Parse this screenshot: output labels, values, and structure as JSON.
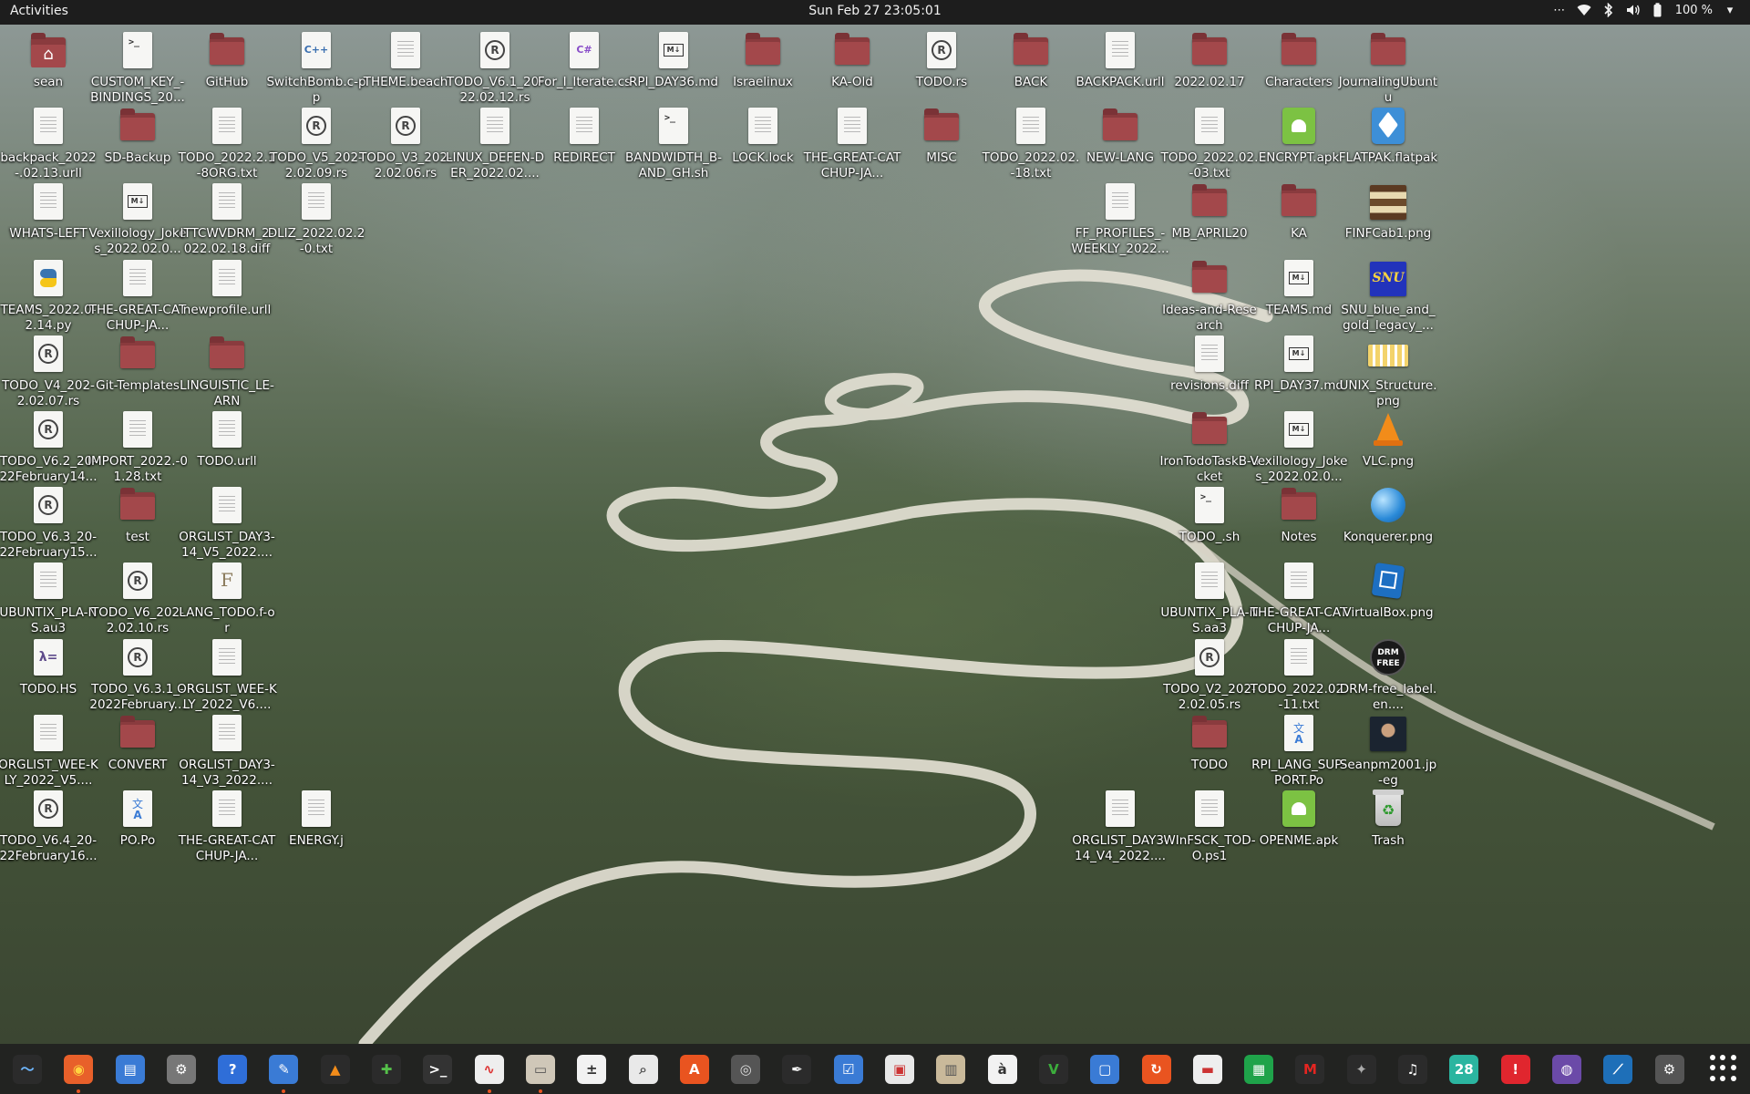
{
  "topbar": {
    "activities": "Activities",
    "clock": "Sun Feb 27  23:05:01",
    "battery": "100 %",
    "icons": [
      "overflow-icon",
      "wifi-icon",
      "bluetooth-icon",
      "volume-icon",
      "battery-icon",
      "chevron-down-icon"
    ]
  },
  "desktop": {
    "items": [
      {
        "label": "sean",
        "type": "home",
        "col": 0,
        "row": 0
      },
      {
        "label": "CUSTOM_KEY_-BINDINGS_20...",
        "type": "term",
        "col": 1,
        "row": 0
      },
      {
        "label": "GitHub",
        "type": "folder",
        "col": 2,
        "row": 0
      },
      {
        "label": "SwitchBomb.c-pp",
        "type": "cpp",
        "col": 3,
        "row": 0
      },
      {
        "label": "THEME.beach",
        "type": "file",
        "col": 4,
        "row": 0
      },
      {
        "label": "TODO_V6.1_20-22.02.12.rs",
        "type": "rust",
        "col": 5,
        "row": 0
      },
      {
        "label": "For_I_Iterate.cs",
        "type": "cs",
        "col": 6,
        "row": 0
      },
      {
        "label": "RPI_DAY36.md",
        "type": "md",
        "col": 7,
        "row": 0
      },
      {
        "label": "Israelinux",
        "type": "folder",
        "col": 8,
        "row": 0
      },
      {
        "label": "KA-Old",
        "type": "folder",
        "col": 9,
        "row": 0
      },
      {
        "label": "TODO.rs",
        "type": "rust",
        "col": 10,
        "row": 0
      },
      {
        "label": "BACK",
        "type": "folder",
        "col": 11,
        "row": 0
      },
      {
        "label": "BACKPACK.urll",
        "type": "file",
        "col": 12,
        "row": 0
      },
      {
        "label": "2022.02.17",
        "type": "folder",
        "col": 13,
        "row": 0
      },
      {
        "label": "Characters",
        "type": "folder",
        "col": 14,
        "row": 0
      },
      {
        "label": "JournalingUbuntu",
        "type": "folder",
        "col": 15,
        "row": 0
      },
      {
        "label": "backpack_2022-.02.13.urll",
        "type": "file",
        "col": 0,
        "row": 1
      },
      {
        "label": "SD-Backup",
        "type": "folder",
        "col": 1,
        "row": 1
      },
      {
        "label": "TODO_2022.2.1-8ORG.txt",
        "type": "file",
        "col": 2,
        "row": 1
      },
      {
        "label": "TODO_V5_202-2.02.09.rs",
        "type": "rust",
        "col": 3,
        "row": 1
      },
      {
        "label": "TODO_V3_202-2.02.06.rs",
        "type": "rust",
        "col": 4,
        "row": 1
      },
      {
        "label": "LINUX_DEFEN-DER_2022.02....",
        "type": "file",
        "col": 5,
        "row": 1
      },
      {
        "label": "REDIRECT",
        "type": "file",
        "col": 6,
        "row": 1
      },
      {
        "label": "BANDWIDTH_B-AND_GH.sh",
        "type": "term",
        "col": 7,
        "row": 1
      },
      {
        "label": "LOCK.lock",
        "type": "file",
        "col": 8,
        "row": 1
      },
      {
        "label": "THE-GREAT-CATCHUP-JA...",
        "type": "file",
        "col": 9,
        "row": 1
      },
      {
        "label": "MISC",
        "type": "folder",
        "col": 10,
        "row": 1
      },
      {
        "label": "TODO_2022.02.-18.txt",
        "type": "file",
        "col": 11,
        "row": 1
      },
      {
        "label": "NEW-LANG",
        "type": "folder",
        "col": 12,
        "row": 1
      },
      {
        "label": "TODO_2022.02.-03.txt",
        "type": "file",
        "col": 13,
        "row": 1
      },
      {
        "label": "ENCRYPT.apk",
        "type": "apk",
        "col": 14,
        "row": 1
      },
      {
        "label": "FLATPAK.flatpak",
        "type": "flatpak",
        "col": 15,
        "row": 1
      },
      {
        "label": "WHATS-LEFT",
        "type": "file",
        "col": 0,
        "row": 2
      },
      {
        "label": "Vexillology_Jokes_2022.02.0...",
        "type": "md",
        "col": 1,
        "row": 2
      },
      {
        "label": "ITTCWVDRM_2-022.02.18.diff",
        "type": "file",
        "col": 2,
        "row": 2
      },
      {
        "label": "DLIZ_2022.02.2-0.txt",
        "type": "file",
        "col": 3,
        "row": 2
      },
      {
        "label": "FF_PROFILES_-WEEKLY_2022...",
        "type": "file",
        "col": 12,
        "row": 2
      },
      {
        "label": "MB_APRIL20",
        "type": "folder",
        "col": 13,
        "row": 2
      },
      {
        "label": "KA",
        "type": "folder",
        "col": 14,
        "row": 2
      },
      {
        "label": "FINFCab1.png",
        "type": "img-cabinet",
        "col": 15,
        "row": 2
      },
      {
        "label": "TEAMS_2022.0-2.14.py",
        "type": "py",
        "col": 0,
        "row": 3
      },
      {
        "label": "THE-GREAT-CATCHUP-JA...",
        "type": "file",
        "col": 1,
        "row": 3
      },
      {
        "label": "newprofile.urll",
        "type": "file",
        "col": 2,
        "row": 3
      },
      {
        "label": "Ideas-and-Research",
        "type": "folder",
        "col": 13,
        "row": 3
      },
      {
        "label": "TEAMS.md",
        "type": "md",
        "col": 14,
        "row": 3
      },
      {
        "label": "SNU_blue_and_gold_legacy_...",
        "type": "img-snu",
        "col": 15,
        "row": 3
      },
      {
        "label": "TODO_V4_202-2.02.07.rs",
        "type": "rust",
        "col": 0,
        "row": 4
      },
      {
        "label": "Git-Templates",
        "type": "folder",
        "col": 1,
        "row": 4
      },
      {
        "label": "LINGUISTIC_LE-ARN",
        "type": "folder",
        "col": 2,
        "row": 4
      },
      {
        "label": "revisions.diff",
        "type": "file",
        "col": 13,
        "row": 4
      },
      {
        "label": "RPI_DAY37.md",
        "type": "md",
        "col": 14,
        "row": 4
      },
      {
        "label": "UNIX_Structure.png",
        "type": "img-unix",
        "col": 15,
        "row": 4
      },
      {
        "label": "TODO_V6.2_20-22February14...",
        "type": "rust",
        "col": 0,
        "row": 5
      },
      {
        "label": "IMPORT_2022.-01.28.txt",
        "type": "file",
        "col": 1,
        "row": 5
      },
      {
        "label": "TODO.urll",
        "type": "file",
        "col": 2,
        "row": 5
      },
      {
        "label": "IronTodoTaskB-ucket",
        "type": "folder",
        "col": 13,
        "row": 5
      },
      {
        "label": "Vexillology_Jokes_2022.02.0...",
        "type": "md",
        "col": 14,
        "row": 5
      },
      {
        "label": "VLC.png",
        "type": "vlc",
        "col": 15,
        "row": 5
      },
      {
        "label": "TODO_V6.3_20-22February15...",
        "type": "rust",
        "col": 0,
        "row": 6
      },
      {
        "label": "test",
        "type": "folder",
        "col": 1,
        "row": 6
      },
      {
        "label": "ORGLIST_DAY3-14_V5_2022....",
        "type": "file",
        "col": 2,
        "row": 6
      },
      {
        "label": "TODO_.sh",
        "type": "term",
        "col": 13,
        "row": 6
      },
      {
        "label": "Notes",
        "type": "folder",
        "col": 14,
        "row": 6
      },
      {
        "label": "Konquerer.png",
        "type": "globe",
        "col": 15,
        "row": 6
      },
      {
        "label": "UBUNTIX_PLA-NS.au3",
        "type": "file",
        "col": 0,
        "row": 7
      },
      {
        "label": "TODO_V6_202-2.02.10.rs",
        "type": "rust",
        "col": 1,
        "row": 7
      },
      {
        "label": "LANG_TODO.f-or",
        "type": "fortran",
        "col": 2,
        "row": 7
      },
      {
        "label": "UBUNTIX_PLA-NS.aa3",
        "type": "file",
        "col": 13,
        "row": 7
      },
      {
        "label": "THE-GREAT-CATCHUP-JA...",
        "type": "file",
        "col": 14,
        "row": 7
      },
      {
        "label": "VirtualBox.png",
        "type": "vbox",
        "col": 15,
        "row": 7
      },
      {
        "label": "TODO.HS",
        "type": "haskell",
        "col": 0,
        "row": 8
      },
      {
        "label": "TODO_V6.3.1_-2022February...",
        "type": "rust",
        "col": 1,
        "row": 8
      },
      {
        "label": "ORGLIST_WEE-KLY_2022_V6....",
        "type": "file",
        "col": 2,
        "row": 8
      },
      {
        "label": "TODO_V2_202-2.02.05.rs",
        "type": "rust",
        "col": 13,
        "row": 8
      },
      {
        "label": "TODO_2022.02.-11.txt",
        "type": "file",
        "col": 14,
        "row": 8
      },
      {
        "label": "DRM-free_label.en....",
        "type": "drm",
        "col": 15,
        "row": 8
      },
      {
        "label": "ORGLIST_WEE-KLY_2022_V5....",
        "type": "file",
        "col": 0,
        "row": 9
      },
      {
        "label": "CONVERT",
        "type": "folder",
        "col": 1,
        "row": 9
      },
      {
        "label": "ORGLIST_DAY3-14_V3_2022....",
        "type": "file",
        "col": 2,
        "row": 9
      },
      {
        "label": "TODO",
        "type": "folder",
        "col": 13,
        "row": 9
      },
      {
        "label": "RPI_LANG_SUP-PORT.Po",
        "type": "po",
        "col": 14,
        "row": 9
      },
      {
        "label": "Seanpm2001.jp-eg",
        "type": "img-photo",
        "col": 15,
        "row": 9
      },
      {
        "label": "TODO_V6.4_20-22February16...",
        "type": "rust",
        "col": 0,
        "row": 10
      },
      {
        "label": "PO.Po",
        "type": "po",
        "col": 1,
        "row": 10
      },
      {
        "label": "THE-GREAT-CATCHUP-JA...",
        "type": "file",
        "col": 2,
        "row": 10
      },
      {
        "label": "ENERGY.j",
        "type": "file",
        "col": 3,
        "row": 10
      },
      {
        "label": "ORGLIST_DAY3-14_V4_2022....",
        "type": "file",
        "col": 12,
        "row": 10
      },
      {
        "label": "WInFSCK_TOD-O.ps1",
        "type": "file",
        "col": 13,
        "row": 10
      },
      {
        "label": "OPENME.apk",
        "type": "apk",
        "col": 14,
        "row": 10
      },
      {
        "label": "Trash",
        "type": "trash",
        "col": 15,
        "row": 10
      }
    ]
  },
  "dock": {
    "apps": [
      {
        "name": "system-monitor-icon",
        "bg": "#2b2b2b",
        "fg": "#6fb7ff",
        "glyph": "〜",
        "running": false
      },
      {
        "name": "firefox-icon",
        "bg": "#e8602a",
        "fg": "#ffd23f",
        "glyph": "◉",
        "running": true
      },
      {
        "name": "document-viewer-icon",
        "bg": "#3a7bd5",
        "fg": "#fff",
        "glyph": "▤",
        "running": false
      },
      {
        "name": "settings-gear-icon",
        "bg": "#777",
        "fg": "#fff",
        "glyph": "⚙",
        "running": false
      },
      {
        "name": "help-icon",
        "bg": "#2f6ed8",
        "fg": "#fff",
        "glyph": "?",
        "running": false
      },
      {
        "name": "text-editor-icon",
        "bg": "#3a7bd5",
        "fg": "#fff",
        "glyph": "✎",
        "running": true
      },
      {
        "name": "vlc-icon",
        "bg": "#2b2b2b",
        "fg": "#f28c1a",
        "glyph": "▲",
        "running": false
      },
      {
        "name": "puzzle-icon",
        "bg": "#2b2b2b",
        "fg": "#55c04a",
        "glyph": "✚",
        "running": false
      },
      {
        "name": "terminal-icon",
        "bg": "#333",
        "fg": "#fff",
        "glyph": ">_",
        "running": false
      },
      {
        "name": "activity-chart-icon",
        "bg": "#eee",
        "fg": "#d33",
        "glyph": "∿",
        "running": true
      },
      {
        "name": "files-icon",
        "bg": "#cfc7b8",
        "fg": "#555",
        "glyph": "▭",
        "running": true
      },
      {
        "name": "calculator-icon",
        "bg": "#f2f2f2",
        "fg": "#333",
        "glyph": "±",
        "running": false
      },
      {
        "name": "image-viewer-icon",
        "bg": "#e9e9e9",
        "fg": "#555",
        "glyph": "⌕",
        "running": false
      },
      {
        "name": "software-center-icon",
        "bg": "#e95420",
        "fg": "#fff",
        "glyph": "A",
        "running": false
      },
      {
        "name": "disks-icon",
        "bg": "#555",
        "fg": "#ddd",
        "glyph": "◎",
        "running": false
      },
      {
        "name": "inkscape-icon",
        "bg": "#2b2b2b",
        "fg": "#fff",
        "glyph": "✒",
        "running": false
      },
      {
        "name": "tasks-icon",
        "bg": "#3a7bd5",
        "fg": "#fff",
        "glyph": "☑",
        "running": false
      },
      {
        "name": "screenshot-icon",
        "bg": "#e8e8e8",
        "fg": "#c33",
        "glyph": "▣",
        "running": false
      },
      {
        "name": "archive-icon",
        "bg": "#c9b99a",
        "fg": "#555",
        "glyph": "▥",
        "running": false
      },
      {
        "name": "character-map-icon",
        "bg": "#f2f2f2",
        "fg": "#333",
        "glyph": "à",
        "running": false
      },
      {
        "name": "vim-icon",
        "bg": "#2b2b2b",
        "fg": "#3cae3c",
        "glyph": "V",
        "running": false
      },
      {
        "name": "remote-desktop-icon",
        "bg": "#3a7bd5",
        "fg": "#fff",
        "glyph": "▢",
        "running": false
      },
      {
        "name": "update-manager-icon",
        "bg": "#e95420",
        "fg": "#fff",
        "glyph": "↻",
        "running": false
      },
      {
        "name": "pdf-viewer-icon",
        "bg": "#eee",
        "fg": "#c33",
        "glyph": "▬",
        "running": false
      },
      {
        "name": "spreadsheet-icon",
        "bg": "#1fa34a",
        "fg": "#fff",
        "glyph": "▦",
        "running": false
      },
      {
        "name": "game-mario-icon",
        "bg": "#2b2b2b",
        "fg": "#e52521",
        "glyph": "M",
        "running": false
      },
      {
        "name": "gimp-icon",
        "bg": "#2b2b2b",
        "fg": "#aaa",
        "glyph": "✦",
        "running": false
      },
      {
        "name": "music-icon",
        "bg": "#2b2b2b",
        "fg": "#fff",
        "glyph": "♫",
        "running": false
      },
      {
        "name": "calendar-icon",
        "bg": "#2bb5a0",
        "fg": "#fff",
        "glyph": "28",
        "running": false
      },
      {
        "name": "alert-icon",
        "bg": "#e0262e",
        "fg": "#fff",
        "glyph": "!",
        "running": false
      },
      {
        "name": "camera-icon",
        "bg": "#6b4aa8",
        "fg": "#fff",
        "glyph": "◍",
        "running": false
      },
      {
        "name": "stocks-chart-icon",
        "bg": "#1e6fb8",
        "fg": "#fff",
        "glyph": "⟋",
        "running": false
      },
      {
        "name": "steam-icon",
        "bg": "#555",
        "fg": "#fff",
        "glyph": "⚙",
        "running": false
      }
    ]
  },
  "apps_grid": {
    "icon": "show-applications-icon"
  }
}
